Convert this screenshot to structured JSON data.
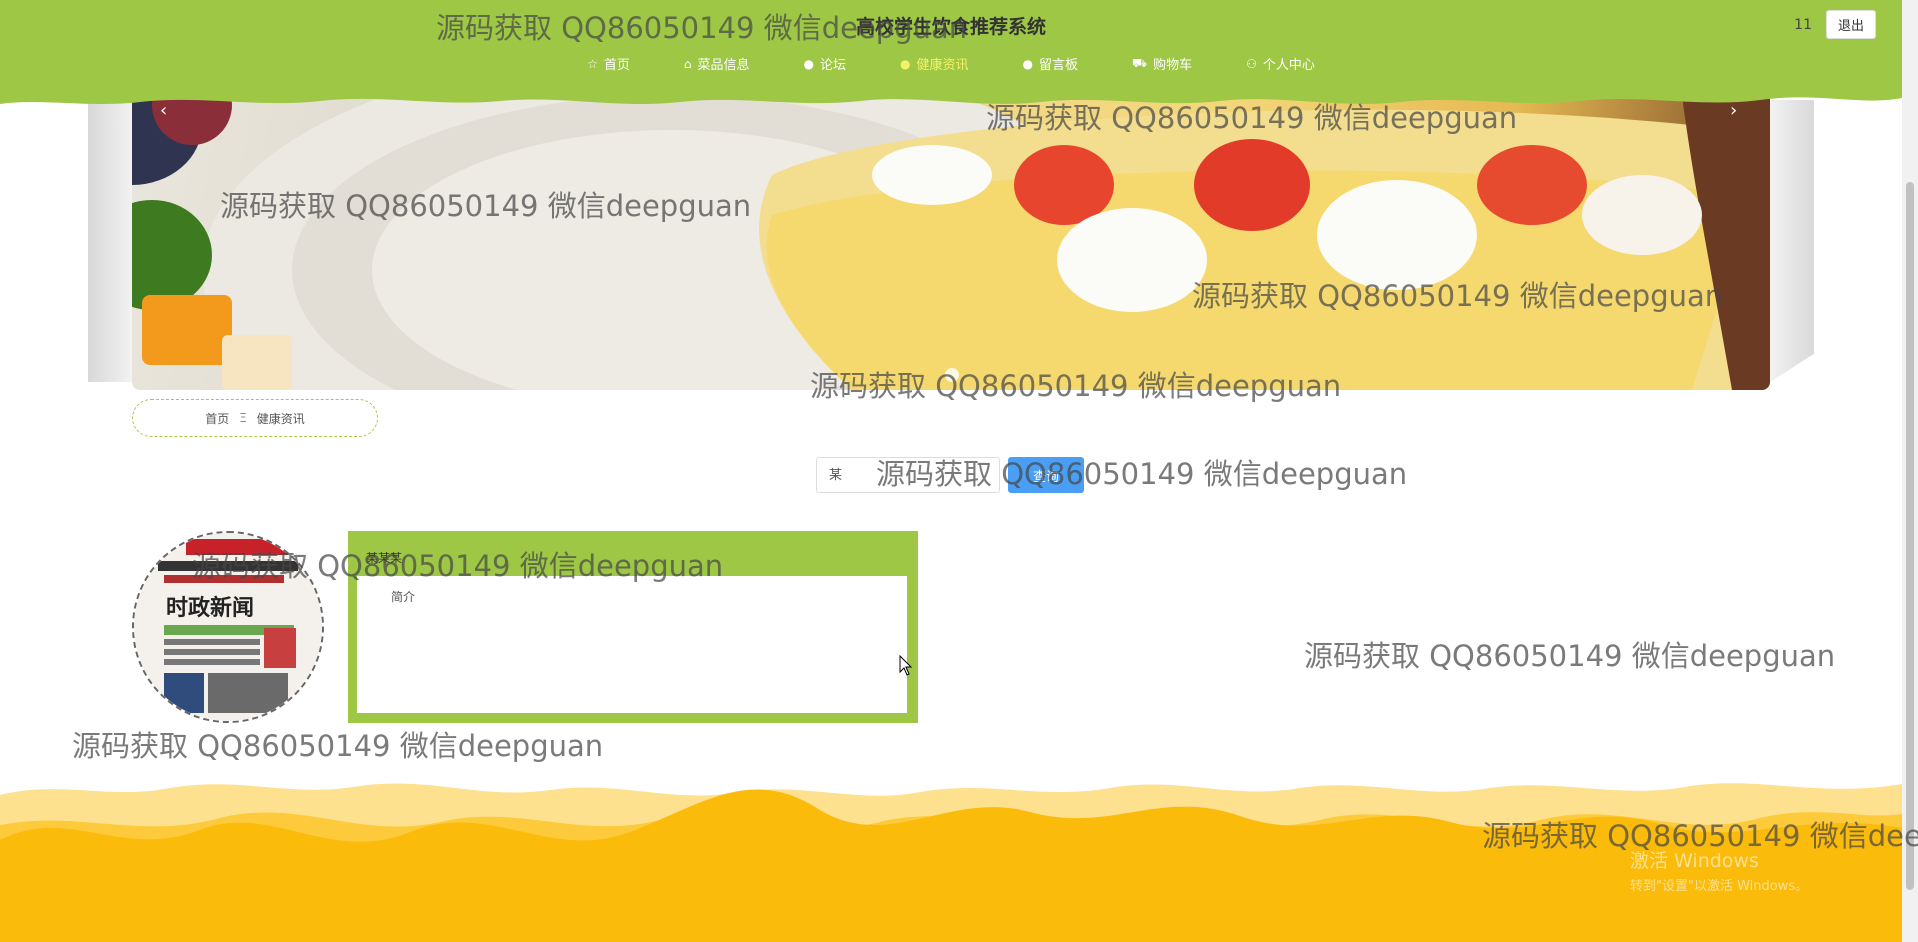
{
  "site": {
    "title": "高校学生饮食推荐系统"
  },
  "user": {
    "name": "11",
    "logout_label": "退出"
  },
  "nav": {
    "items": [
      {
        "label": "首页",
        "icon": "star-icon"
      },
      {
        "label": "菜品信息",
        "icon": "bag-icon"
      },
      {
        "label": "论坛",
        "icon": "dot-icon"
      },
      {
        "label": "健康资讯",
        "icon": "dot-icon",
        "active": true
      },
      {
        "label": "留言板",
        "icon": "dot-icon"
      },
      {
        "label": "购物车",
        "icon": "cart-icon"
      },
      {
        "label": "个人中心",
        "icon": "user-icon"
      }
    ]
  },
  "breadcrumb": {
    "home": "首页",
    "separator": "Ξ",
    "current": "健康资讯"
  },
  "search": {
    "placeholder": "某",
    "button_label": "查询"
  },
  "news": {
    "items": [
      {
        "title": "某某某",
        "intro": "简介",
        "thumb_caption": "时政新闻"
      }
    ]
  },
  "watermark_text": "源码获取 QQ86050149 微信deepguan",
  "windows": {
    "line1": "激活 Windows",
    "line2": "转到\"设置\"以激活 Windows。"
  },
  "colors": {
    "brand_green": "#9dc744",
    "search_blue": "#4a9ff5",
    "footer_yellow": "#fbbb0b"
  }
}
